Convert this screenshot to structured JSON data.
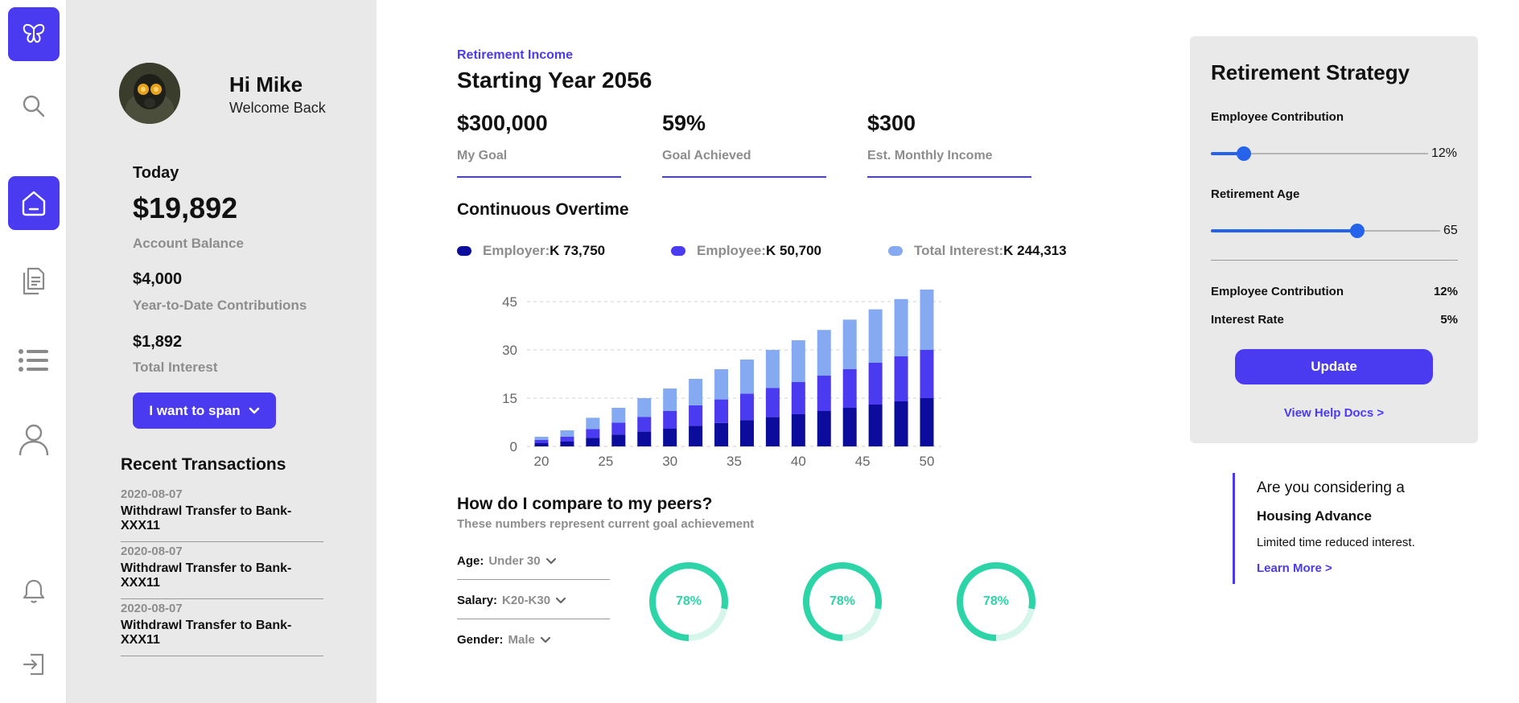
{
  "user": {
    "greeting": "Hi Mike",
    "welcome": "Welcome Back"
  },
  "account": {
    "today_label": "Today",
    "balance": "$19,892",
    "balance_label": "Account Balance",
    "ytd_contributions": "$4,000",
    "ytd_label": "Year-to-Date Contributions",
    "total_interest": "$1,892",
    "interest_label": "Total Interest",
    "action_button": "I want to span"
  },
  "transactions": {
    "title": "Recent Transactions",
    "items": [
      {
        "date": "2020-08-07",
        "description": "Withdrawl Transfer to Bank-XXX11"
      },
      {
        "date": "2020-08-07",
        "description": "Withdrawl Transfer to Bank-XXX11"
      },
      {
        "date": "2020-08-07",
        "description": "Withdrawl Transfer to Bank-XXX11"
      }
    ]
  },
  "main": {
    "overline": "Retirement Income",
    "title": "Starting Year 2056",
    "stats": [
      {
        "value": "$300,000",
        "label": "My Goal"
      },
      {
        "value": "59%",
        "label": "Goal Achieved"
      },
      {
        "value": "$300",
        "label": "Est. Monthly Income"
      }
    ],
    "chart_title": "Continuous Overtime",
    "legend": [
      {
        "name": "Employer:",
        "value": "K 73,750",
        "color": "#0b0b9c"
      },
      {
        "name": "Employee:",
        "value": "K 50,700",
        "color": "#4a3af0"
      },
      {
        "name": "Total Interest:",
        "value": "K 244,313",
        "color": "#86aaf2"
      }
    ],
    "peers": {
      "title": "How do I compare to my peers?",
      "subtitle": "These numbers represent current goal achievement",
      "filters": [
        {
          "key": "Age:",
          "value": "Under 30"
        },
        {
          "key": "Salary:",
          "value": "K20-K30"
        },
        {
          "key": "Gender:",
          "value": "Male"
        }
      ],
      "donuts": [
        {
          "label": "78%",
          "value": 0.78
        },
        {
          "label": "78%",
          "value": 0.78
        },
        {
          "label": "78%",
          "value": 0.78
        }
      ],
      "donut_color": "#2dd4a8",
      "donut_track": "#d6f6ec"
    }
  },
  "chart_data": {
    "type": "bar",
    "stacked": true,
    "x": [
      20,
      22,
      24,
      26,
      28,
      30,
      32,
      34,
      36,
      38,
      40,
      42,
      44,
      46,
      48,
      50
    ],
    "x_ticks": [
      "20",
      "25",
      "30",
      "35",
      "40",
      "45",
      "50"
    ],
    "x_tick_values": [
      20,
      25,
      30,
      35,
      40,
      45,
      50
    ],
    "y_ticks": [
      "0",
      "15",
      "30",
      "45"
    ],
    "ylim": [
      0,
      45
    ],
    "grid": true,
    "series": [
      {
        "name": "Employer",
        "color": "#0b0b9c",
        "values": [
          1,
          1.5,
          2.7,
          3.7,
          4.6,
          5.5,
          6.4,
          7.3,
          8.2,
          9.1,
          10,
          11,
          12,
          13,
          14,
          15
        ]
      },
      {
        "name": "Employee",
        "color": "#4a3af0",
        "values": [
          1,
          1.5,
          2.7,
          3.7,
          4.6,
          5.5,
          6.4,
          7.3,
          8.2,
          9.1,
          10,
          11,
          12,
          13,
          14,
          15
        ]
      },
      {
        "name": "Total Interest",
        "color": "#86aaf2",
        "values": [
          1,
          2,
          3.5,
          4.6,
          5.8,
          7,
          8.2,
          9.4,
          10.6,
          11.8,
          13,
          14.2,
          15.4,
          16.6,
          17.8,
          19
        ]
      }
    ]
  },
  "strategy": {
    "title": "Retirement Strategy",
    "employee_contribution_label": "Employee Contribution",
    "employee_contribution_value": "12%",
    "employee_contribution_fraction": 0.15,
    "retirement_age_label": "Retirement Age",
    "retirement_age_value": "65",
    "retirement_age_fraction": 0.64,
    "summary": [
      {
        "label": "Employee Contribution",
        "value": "12%"
      },
      {
        "label": "Interest Rate",
        "value": "5%"
      }
    ],
    "update_button": "Update",
    "help_link": "View Help Docs >"
  },
  "promo": {
    "question": "Are you considering a",
    "headline": "Housing Advance",
    "description": "Limited time reduced interest.",
    "link": "Learn More >"
  },
  "colors": {
    "accent": "#4a3af0",
    "slider": "#2563eb",
    "panel": "#e9e9e9"
  },
  "icons": [
    "butterfly-logo-icon",
    "search-icon",
    "home-icon",
    "documents-icon",
    "list-icon",
    "user-icon",
    "bell-icon",
    "logout-icon",
    "chevron-down-icon"
  ]
}
